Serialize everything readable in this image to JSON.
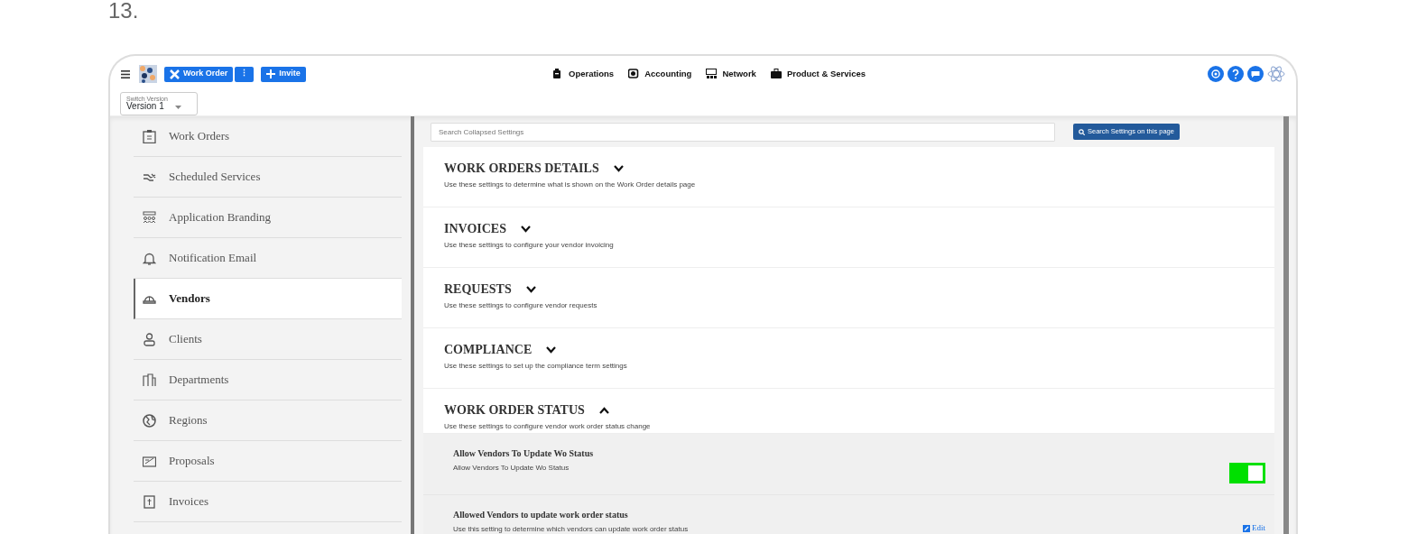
{
  "step_number": "13.",
  "topbar": {
    "work_order_button": "Work Order",
    "more_button": "⋮",
    "invite_button": "Invite",
    "nav": [
      {
        "label": "Operations"
      },
      {
        "label": "Accounting"
      },
      {
        "label": "Network"
      },
      {
        "label": "Product & Services"
      }
    ]
  },
  "version_select": {
    "label": "Switch Version",
    "value": "Version 1"
  },
  "sidebar": {
    "items": [
      {
        "label": "Work Orders",
        "selected": false
      },
      {
        "label": "Scheduled Services",
        "selected": false
      },
      {
        "label": "Application Branding",
        "selected": false
      },
      {
        "label": "Notification Email",
        "selected": false
      },
      {
        "label": "Vendors",
        "selected": true
      },
      {
        "label": "Clients",
        "selected": false
      },
      {
        "label": "Departments",
        "selected": false
      },
      {
        "label": "Regions",
        "selected": false
      },
      {
        "label": "Proposals",
        "selected": false
      },
      {
        "label": "Invoices",
        "selected": false
      }
    ]
  },
  "search": {
    "placeholder": "Search Collapsed Settings",
    "button": "Search Settings on this page"
  },
  "sections": [
    {
      "title": "WORK ORDERS DETAILS",
      "description": "Use these settings to determine what is shown on the Work Order details page",
      "expanded": false
    },
    {
      "title": "INVOICES",
      "description": "Use these settings to configure your vendor invoicing",
      "expanded": false
    },
    {
      "title": "REQUESTS",
      "description": "Use these settings to configure vendor requests",
      "expanded": false
    },
    {
      "title": "COMPLIANCE",
      "description": "Use these settings to set up the compliance term settings",
      "expanded": false
    },
    {
      "title": "WORK ORDER STATUS",
      "description": "Use these settings to configure vendor work order status change",
      "expanded": true,
      "settings": [
        {
          "kind": "toggle",
          "title": "Allow Vendors To Update Wo Status",
          "description": "Allow Vendors To Update Wo Status",
          "on": true
        },
        {
          "kind": "edit",
          "title": "Allowed Vendors to update work order status",
          "description": "Use this setting to determine which vendors can update work order status",
          "action": "Edit"
        }
      ]
    }
  ]
}
